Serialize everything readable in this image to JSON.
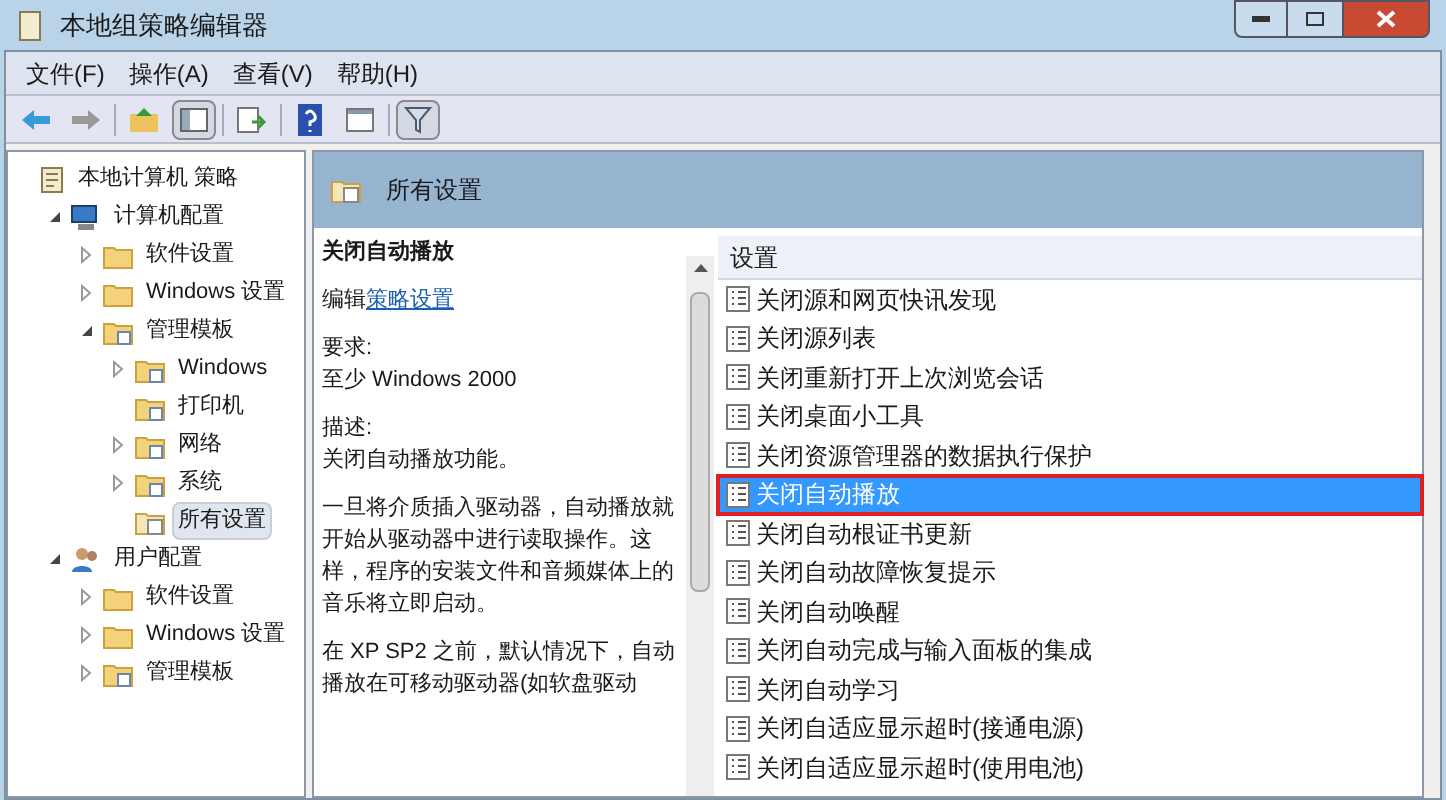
{
  "window": {
    "title": "本地组策略编辑器"
  },
  "menu": [
    "文件(F)",
    "操作(A)",
    "查看(V)",
    "帮助(H)"
  ],
  "tree": [
    {
      "label": "本地计算机 策略",
      "kind": "policy",
      "selected": false,
      "children": [
        {
          "label": "计算机配置",
          "kind": "computer",
          "selected": false,
          "expanded": true,
          "children": [
            {
              "label": "软件设置",
              "kind": "folder",
              "selected": false,
              "expanded": false
            },
            {
              "label": "Windows 设置",
              "kind": "folder",
              "selected": false,
              "expanded": false
            },
            {
              "label": "管理模板",
              "kind": "template",
              "selected": false,
              "expanded": true,
              "children": [
                {
                  "label": "Windows",
                  "kind": "template",
                  "selected": false,
                  "expanded": false
                },
                {
                  "label": "打印机",
                  "kind": "template",
                  "selected": false
                },
                {
                  "label": "网络",
                  "kind": "template",
                  "selected": false,
                  "expanded": false
                },
                {
                  "label": "系统",
                  "kind": "template",
                  "selected": false,
                  "expanded": false
                },
                {
                  "label": "所有设置",
                  "kind": "allsettings",
                  "selected": true
                }
              ]
            }
          ]
        },
        {
          "label": "用户配置",
          "kind": "user",
          "selected": false,
          "expanded": true,
          "children": [
            {
              "label": "软件设置",
              "kind": "folder",
              "selected": false,
              "expanded": false
            },
            {
              "label": "Windows 设置",
              "kind": "folder",
              "selected": false,
              "expanded": false
            },
            {
              "label": "管理模板",
              "kind": "template",
              "selected": false,
              "expanded": false
            }
          ]
        }
      ]
    }
  ],
  "header": {
    "title": "所有设置"
  },
  "detail": {
    "title": "关闭自动播放",
    "edit_prefix": "编辑",
    "edit_link": "策略设置",
    "requirement_label": "要求:",
    "requirement": "至少 Windows 2000",
    "description_label": "描述:",
    "description": "关闭自动播放功能。",
    "paragraphs": [
      "一旦将介质插入驱动器，自动播放就开始从驱动器中进行读取操作。这样，程序的安装文件和音频媒体上的音乐将立即启动。",
      "在 XP SP2 之前，默认情况下，自动播放在可移动驱动器(如软盘驱动"
    ]
  },
  "list": {
    "column": "设置",
    "rows": [
      {
        "label": "关闭源和网页快讯发现",
        "selected": false
      },
      {
        "label": "关闭源列表",
        "selected": false
      },
      {
        "label": "关闭重新打开上次浏览会话",
        "selected": false
      },
      {
        "label": "关闭桌面小工具",
        "selected": false
      },
      {
        "label": "关闭资源管理器的数据执行保护",
        "selected": false
      },
      {
        "label": "关闭自动播放",
        "selected": true
      },
      {
        "label": "关闭自动根证书更新",
        "selected": false
      },
      {
        "label": "关闭自动故障恢复提示",
        "selected": false
      },
      {
        "label": "关闭自动唤醒",
        "selected": false
      },
      {
        "label": "关闭自动完成与输入面板的集成",
        "selected": false
      },
      {
        "label": "关闭自动学习",
        "selected": false
      },
      {
        "label": "关闭自适应显示超时(接通电源)",
        "selected": false
      },
      {
        "label": "关闭自适应显示超时(使用电池)",
        "selected": false
      }
    ]
  }
}
